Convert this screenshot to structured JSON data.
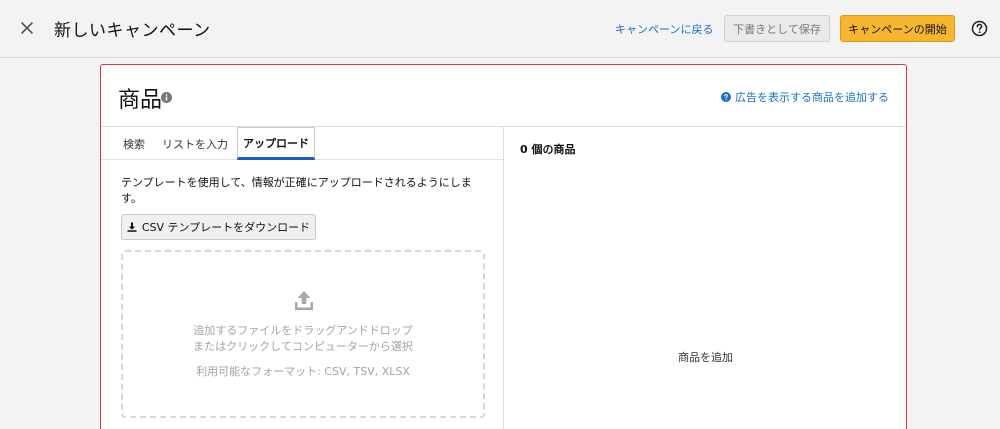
{
  "header": {
    "title": "新しいキャンペーン",
    "back_link": "キャンペーンに戻る",
    "save_draft": "下書きとして保存",
    "start_campaign": "キャンペーンの開始"
  },
  "products": {
    "title": "商品",
    "add_link": "広告を表示する商品を追加する",
    "tabs": [
      {
        "label": "検索"
      },
      {
        "label": "リストを入力"
      },
      {
        "label": "アップロード"
      }
    ],
    "active_tab": "アップロード",
    "description": "テンプレートを使用して、情報が正確にアップロードされるようにします。",
    "download_button": "CSV テンプレートをダウンロード",
    "dropzone": {
      "line1": "追加するファイルをドラッグアンドドロップ",
      "line2": "またはクリックしてコンピューターから選択",
      "formats": "利用可能なフォーマット: CSV, TSV, XLSX"
    },
    "count_label": "0 個の商品",
    "empty_label": "商品を追加"
  },
  "colors": {
    "accent_blue": "#1a6ec7",
    "primary_button": "#f7b630",
    "card_border": "#d8363a",
    "tab_underline": "#1d5fa8"
  },
  "icons": {
    "close": "close-icon",
    "help": "help-circle-icon",
    "info": "info-icon",
    "question": "question-circle-icon",
    "download": "download-icon",
    "upload": "upload-icon"
  }
}
